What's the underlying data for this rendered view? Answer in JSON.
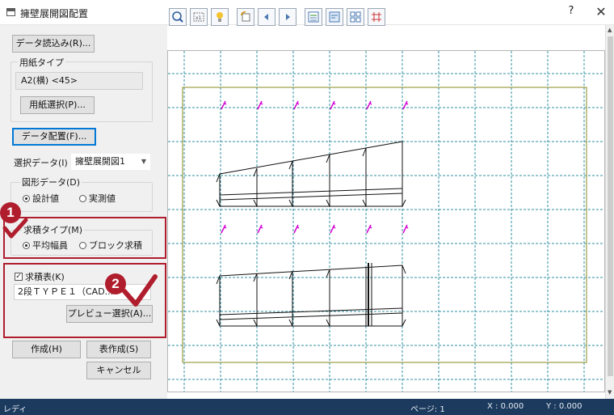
{
  "window": {
    "title": "擁壁展開図配置",
    "help": "?",
    "close": "✕"
  },
  "left": {
    "read_data_btn": "データ読込み(R)...",
    "paper_type_group": "用紙タイプ",
    "paper_type_value": "A2(横) <45>",
    "paper_select_btn": "用紙選択(P)...",
    "data_place_btn": "データ配置(F)...",
    "select_data_label": "選択データ(I)",
    "select_data_value": "擁壁展開図1",
    "shape_data_group": "図形データ(D)",
    "radio_design": "設計値",
    "radio_measured": "実測値",
    "calc_type_group": "求積タイプ(M)",
    "radio_avg_width": "平均幅員",
    "radio_block": "ブロック求積",
    "area_table_check": "求積表(K)",
    "area_table_value": "2段ＴＹＰＥ１（CAD...",
    "preview_select_btn": "プレビュー選択(A)...",
    "create_btn": "作成(H)",
    "table_create_btn": "表作成(S)",
    "cancel_btn": "キャンセル"
  },
  "callouts": {
    "one": "1",
    "two": "2"
  },
  "toolbar": {
    "icons": [
      "zoom-icon",
      "fit-page-icon",
      "bulb-icon",
      "rotate-icon",
      "prev-icon",
      "next-icon",
      "layout-list-icon",
      "layout-detail-icon",
      "layout-grid-icon",
      "grid-lines-icon"
    ]
  },
  "status": {
    "ready": "レディ",
    "page": "ページ: 1",
    "x": "X : 0.000",
    "y": "Y : 0.000"
  },
  "colors": {
    "callout": "#b01e2e",
    "grid": "#2f8fa0",
    "frame": "#8a8a1e",
    "marker": "#d400d4",
    "status_bg": "#1b3a5e"
  }
}
